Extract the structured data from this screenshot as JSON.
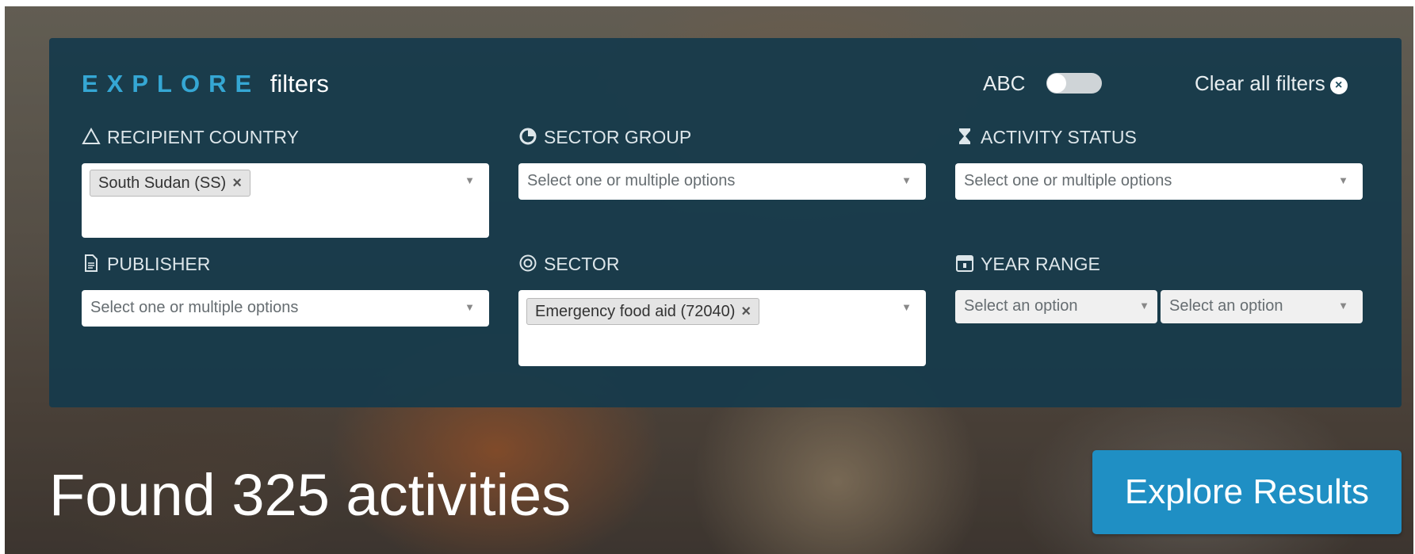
{
  "header": {
    "title_accent": "EXPLORE",
    "title_rest": "filters",
    "toggle_label": "ABC",
    "clear_label": "Clear all filters",
    "clear_icon": "×"
  },
  "filters": {
    "recipient_country": {
      "label": "RECIPIENT COUNTRY",
      "selected": "South Sudan (SS)"
    },
    "sector_group": {
      "label": "SECTOR GROUP",
      "placeholder": "Select one or multiple options"
    },
    "activity_status": {
      "label": "ACTIVITY STATUS",
      "placeholder": "Select one or multiple options"
    },
    "publisher": {
      "label": "PUBLISHER",
      "placeholder": "Select one or multiple options"
    },
    "sector": {
      "label": "SECTOR",
      "selected": "Emergency food aid (72040)"
    },
    "year_range": {
      "label": "YEAR RANGE",
      "from_placeholder": "Select an option",
      "to_placeholder": "Select an option"
    }
  },
  "results": {
    "found_text": "Found 325 activities",
    "button_label": "Explore Results"
  },
  "icons": {
    "remove": "×",
    "dropdown": "▼"
  },
  "colors": {
    "accent": "#35a7d4",
    "panel": "#163a4b",
    "button": "#1f8fc4"
  }
}
